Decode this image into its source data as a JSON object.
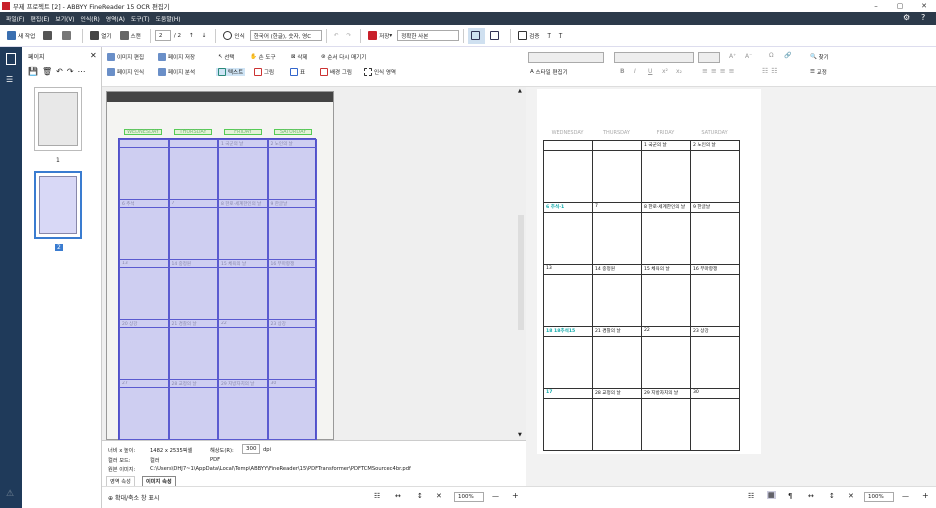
{
  "window": {
    "title": "무제 프로젝트 [2] - ABBYY FineReader 15 OCR 편집기",
    "minimize": "–",
    "maximize": "▢",
    "close": "✕"
  },
  "menu": [
    "파일(F)",
    "편집(E)",
    "보기(V)",
    "인식(R)",
    "영역(A)",
    "도구(T)",
    "도움말(H)"
  ],
  "toolbar": {
    "new_task": "새 작업",
    "open": "열기",
    "scan": "스캔",
    "page_current": "2",
    "page_total": "/ 2",
    "recognize": "인식",
    "language": "한국어 (한글), 숫자, 영C",
    "save": "저장",
    "save_mode": "정확한 사본",
    "verify": "검증"
  },
  "pages_panel": {
    "title": "페이지",
    "thumb1_num": "1",
    "thumb2_num": "2"
  },
  "image_toolbar": {
    "edit_image": "이미지 편집",
    "save_page": "페이지 저장",
    "recognize_page": "페이지 인식",
    "analyze_page": "페이지 분석",
    "select": "선택",
    "hand": "손 도구",
    "delete": "삭제",
    "reorder": "순서 다시 매기기",
    "text": "텍스트",
    "picture": "그림",
    "table": "표",
    "bg_picture": "배경 그림",
    "recog_area": "인식 영역"
  },
  "scan_cal": {
    "headers": [
      "WEDNESDAY",
      "THURSDAY",
      "FRIDAY",
      "SATURDAY"
    ],
    "rows": [
      [
        "",
        "",
        "1 국군의 날",
        "2 노인의 날"
      ],
      [
        "6 추석",
        "7",
        "8 한로·세계한인의 날",
        "9 한글날"
      ],
      [
        "13",
        "14 중정원",
        "15 체육의 날",
        "16 부마항쟁"
      ],
      [
        "20 상강",
        "21 경찰의 날",
        "22",
        "23 상강"
      ],
      [
        "27",
        "28 교정의 날",
        "29 지방자치의 날",
        "30"
      ]
    ]
  },
  "info": {
    "size_label": "너비 x 높이:",
    "size_value": "1482 x 2535픽셀",
    "res_label": "해상도(R):",
    "res_value": "300",
    "res_unit": "dpi",
    "color_label": "컬러 모드:",
    "color_value": "컬러",
    "fmt_value": "PDF",
    "src_label": "원본 이미지:",
    "src_value": "C:\\Users\\DHJ7~1\\AppData\\Local\\Temp\\ABBYY\\FineReader\\15\\PDFTransformer\\PDFTCMSourcec4br.pdf",
    "tab1": "영역 속성",
    "tab2": "이미지 속성"
  },
  "bottom_left": {
    "zoom_toggle": "확대/축소 창 표시",
    "zoom": "100%",
    "minus": "—",
    "plus": "+"
  },
  "text_toolbar": {
    "style_editor": "스타일 편집기",
    "find": "찾기",
    "correct": "교정",
    "bold": "B",
    "italic": "I",
    "underline": "U",
    "sup": "x²",
    "sub": "x₂",
    "grow": "A⁺",
    "shrink": "A⁻"
  },
  "text_cal": {
    "headers": [
      "WEDNESDAY",
      "THURSDAY",
      "FRIDAY",
      "SATURDAY"
    ],
    "rows": [
      [
        "",
        "",
        "1 국군의 날",
        "2 노인의 날"
      ],
      [
        "6 추석·1",
        "7",
        "8 한로·세계한인의 날",
        "9 한글날"
      ],
      [
        "13",
        "14 중정원",
        "15 체육의 날",
        "16 부마항쟁"
      ],
      [
        "18 18추석15",
        "21 경찰의 날",
        "22",
        "23 상강"
      ],
      [
        "17",
        "28 교정의 날",
        "29 지방자치의 날",
        "30"
      ]
    ]
  },
  "bottom_right": {
    "zoom": "100%",
    "minus": "—",
    "plus": "+"
  }
}
